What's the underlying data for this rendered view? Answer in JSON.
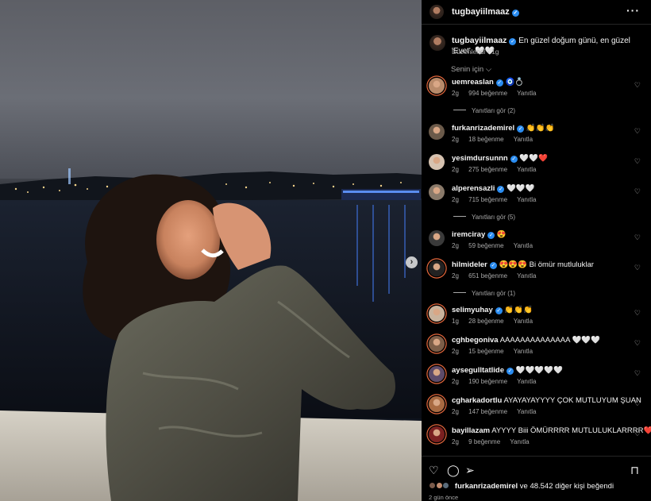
{
  "post": {
    "username": "tugbayiilmaaz",
    "caption_text": "En güzel doğum günü, en güzel 'Evet'. 🤍🤍",
    "edited": "Düzenlendi · 1g",
    "sort_label": "Senin için",
    "more_icon": "more-horizontal-icon"
  },
  "comments": [
    {
      "user": "uemreaslan",
      "verified": true,
      "text": "🧿💍",
      "age": "2g",
      "likes": "994 beğenme",
      "reply": "Yanıtla",
      "replies": "Yanıtları gör (2)"
    },
    {
      "user": "furkanrizademirel",
      "verified": true,
      "text": "👏👏👏",
      "age": "2g",
      "likes": "18 beğenme",
      "reply": "Yanıtla",
      "replies": ""
    },
    {
      "user": "yesimdursunnn",
      "verified": true,
      "text": "🤍🤍❤️",
      "age": "2g",
      "likes": "275 beğenme",
      "reply": "Yanıtla",
      "replies": ""
    },
    {
      "user": "alperensazli",
      "verified": true,
      "text": "🤍🤍🤍",
      "age": "2g",
      "likes": "715 beğenme",
      "reply": "Yanıtla",
      "replies": "Yanıtları gör (5)"
    },
    {
      "user": "iremciray",
      "verified": true,
      "text": "😍",
      "age": "2g",
      "likes": "59 beğenme",
      "reply": "Yanıtla",
      "replies": ""
    },
    {
      "user": "hilmideler",
      "verified": true,
      "text": "😍😍😍 Bi ömür mutluluklar",
      "age": "2g",
      "likes": "651 beğenme",
      "reply": "Yanıtla",
      "replies": "Yanıtları gör (1)"
    },
    {
      "user": "selimyuhay",
      "verified": true,
      "text": "👏👏👏",
      "age": "1g",
      "likes": "28 beğenme",
      "reply": "Yanıtla",
      "replies": ""
    },
    {
      "user": "cghbegoniva",
      "verified": false,
      "text": "AAAAAAAAAAAAAA 🤍🤍🤍",
      "age": "2g",
      "likes": "15 beğenme",
      "reply": "Yanıtla",
      "replies": ""
    },
    {
      "user": "aysegulltatlide",
      "verified": true,
      "text": "🤍🤍🤍🤍🤍",
      "age": "2g",
      "likes": "190 beğenme",
      "reply": "Yanıtla",
      "replies": ""
    },
    {
      "user": "cgharkadortlu",
      "verified": false,
      "text": "AYAYAYAYYYY ÇOK MUTLUYUM ŞUAN",
      "age": "2g",
      "likes": "147 beğenme",
      "reply": "Yanıtla",
      "replies": ""
    },
    {
      "user": "bayillazam",
      "verified": false,
      "text": "AYYYY Biii ÖMÜRRRR MUTLULUKLARRRR❤️🤍🧿",
      "age": "2g",
      "likes": "9 beğenme",
      "reply": "Yanıtla",
      "replies": ""
    }
  ],
  "footer": {
    "liked_by_user": "furkanrizademirel",
    "liked_by_rest": "ve 48.542 diğer kişi beğendi",
    "time": "2 gün önce"
  },
  "colors": {
    "verified": "#2a8cf0",
    "ring": "#e6683c",
    "background": "#000000"
  }
}
